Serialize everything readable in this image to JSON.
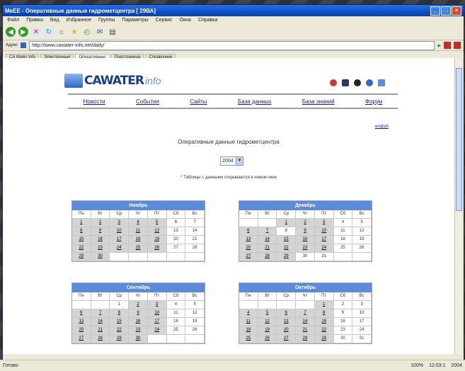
{
  "window": {
    "title": "МеЕЕ - Оперативные данные гидрометцентра [ 29ВА]",
    "buttons": [
      "_",
      "□",
      "×"
    ]
  },
  "menu": [
    "Файл",
    "Правка",
    "Вид",
    "Избранное",
    "Группы",
    "Параметры",
    "Сервис",
    "Окна",
    "Справка"
  ],
  "address": {
    "label": "Адрес",
    "url": "http://www.cawater-info.net/daily/"
  },
  "links_tabs": [
    "CA Water Info",
    "Электронные",
    "Оперативные",
    "Подстраница",
    "Справочник"
  ],
  "site": {
    "logo_part1": "CAWATER",
    "logo_part2": "info",
    "nav": [
      "Новости",
      "События",
      "Сайты",
      "База данных",
      "База знаний",
      "Форум"
    ],
    "english_link": "english",
    "page_title": "Оперативные данные гидрометцентра",
    "year": "2004",
    "note": "* Таблицы с данными открываются в новом окне"
  },
  "calendar_weekdays": [
    "Пн",
    "Вт",
    "Ср",
    "Чт",
    "Пт",
    "Сб",
    "Вс"
  ],
  "calendars": [
    {
      "month": "Ноябрь",
      "cells": [
        "1",
        "2",
        "3",
        "4",
        "5",
        "6",
        "7",
        "8",
        "9",
        "10",
        "11",
        "12",
        "13",
        "14",
        "15",
        "16",
        "17",
        "18",
        "19",
        "20",
        "21",
        "22",
        "23",
        "24",
        "25",
        "26",
        "27",
        "28",
        "29",
        "30",
        "",
        "",
        "",
        "",
        ""
      ],
      "links": [
        "1",
        "2",
        "3",
        "4",
        "5",
        "8",
        "9",
        "10",
        "11",
        "12",
        "15",
        "16",
        "17",
        "18",
        "19",
        "22",
        "23",
        "24",
        "25",
        "26",
        "29",
        "30"
      ]
    },
    {
      "month": "Декабрь",
      "cells": [
        "",
        "",
        "1",
        "2",
        "3",
        "4",
        "5",
        "6",
        "7",
        "8",
        "9",
        "10",
        "11",
        "12",
        "13",
        "14",
        "15",
        "16",
        "17",
        "18",
        "19",
        "20",
        "21",
        "22",
        "23",
        "24",
        "25",
        "26",
        "27",
        "28",
        "29",
        "30",
        "31",
        "",
        ""
      ],
      "links": [
        "1",
        "2",
        "3",
        "6",
        "7",
        "9",
        "10",
        "13",
        "14",
        "15",
        "16",
        "17",
        "20",
        "21",
        "22",
        "23",
        "24",
        "27",
        "28",
        "29"
      ]
    },
    {
      "month": "Сентябрь",
      "cells": [
        "",
        "",
        "1",
        "2",
        "3",
        "4",
        "5",
        "6",
        "7",
        "8",
        "9",
        "10",
        "11",
        "12",
        "13",
        "14",
        "15",
        "16",
        "17",
        "18",
        "19",
        "20",
        "21",
        "22",
        "23",
        "24",
        "25",
        "26",
        "27",
        "28",
        "29",
        "30",
        "",
        "",
        ""
      ],
      "links": [
        "2",
        "3",
        "6",
        "7",
        "8",
        "9",
        "10",
        "13",
        "14",
        "15",
        "16",
        "17",
        "20",
        "21",
        "22",
        "23",
        "24",
        "27",
        "28",
        "29",
        "30"
      ]
    },
    {
      "month": "Октябрь",
      "cells": [
        "",
        "",
        "",
        "",
        "1",
        "2",
        "3",
        "4",
        "5",
        "6",
        "7",
        "8",
        "9",
        "10",
        "11",
        "12",
        "13",
        "14",
        "15",
        "16",
        "17",
        "18",
        "19",
        "20",
        "21",
        "22",
        "23",
        "24",
        "25",
        "26",
        "27",
        "28",
        "29",
        "30",
        "31"
      ],
      "links": [
        "1",
        "4",
        "5",
        "6",
        "7",
        "8",
        "11",
        "12",
        "13",
        "14",
        "15",
        "18",
        "19",
        "20",
        "21",
        "22",
        "25",
        "26",
        "27",
        "28",
        "29"
      ]
    }
  ],
  "status": {
    "left": "Готово",
    "zoom": "100%",
    "time": "12:03:1",
    "year": "2004"
  },
  "colors": {
    "calendar_header": "#5b8bd9",
    "linked_day": "#d4d4d4",
    "titlebar": "#0d4fc9"
  }
}
